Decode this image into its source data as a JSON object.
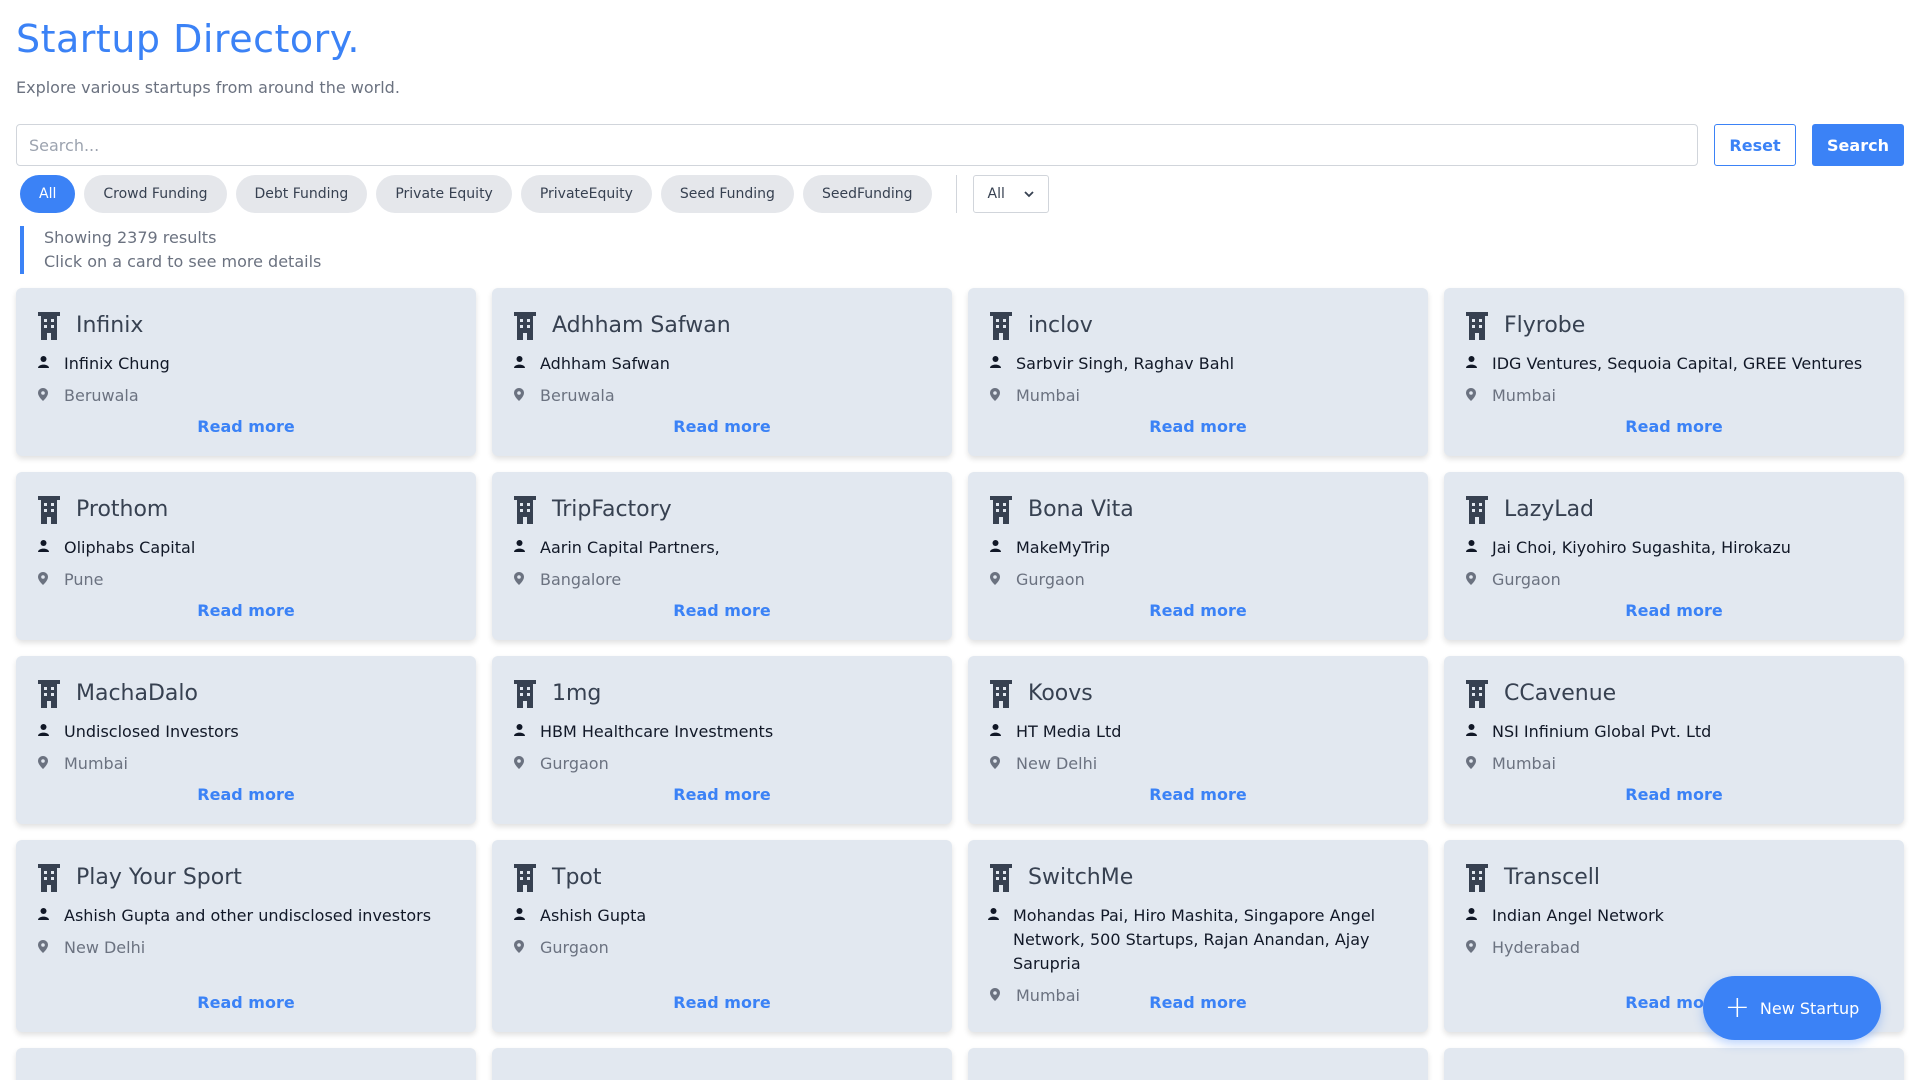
{
  "header": {
    "title": "Startup Directory.",
    "subtitle": "Explore various startups from around the world."
  },
  "search": {
    "placeholder": "Search...",
    "value": "",
    "reset_label": "Reset",
    "search_label": "Search"
  },
  "filters": {
    "chips": [
      "All",
      "Crowd Funding",
      "Debt Funding",
      "Private Equity",
      "PrivateEquity",
      "Seed Funding",
      "SeedFunding"
    ],
    "active": "All",
    "select_value": "All"
  },
  "info": {
    "results": "Showing 2379 results",
    "hint": "Click on a card to see more details"
  },
  "cards": [
    {
      "name": "Infinix",
      "investors": "Infinix Chung",
      "location": "Beruwala"
    },
    {
      "name": "Adhham Safwan",
      "investors": "Adhham Safwan",
      "location": "Beruwala"
    },
    {
      "name": "inclov",
      "investors": "Sarbvir Singh, Raghav Bahl",
      "location": "Mumbai"
    },
    {
      "name": "Flyrobe",
      "investors": "IDG Ventures, Sequoia Capital, GREE Ventures",
      "location": "Mumbai"
    },
    {
      "name": "Prothom",
      "investors": "Oliphabs Capital",
      "location": "Pune"
    },
    {
      "name": "TripFactory",
      "investors": "Aarin Capital Partners,",
      "location": "Bangalore"
    },
    {
      "name": "Bona Vita",
      "investors": "MakeMyTrip",
      "location": "Gurgaon"
    },
    {
      "name": "LazyLad",
      "investors": "Jai Choi, Kiyohiro Sugashita, Hirokazu",
      "location": "Gurgaon"
    },
    {
      "name": "MachaDalo",
      "investors": "Undisclosed Investors",
      "location": "Mumbai"
    },
    {
      "name": "1mg",
      "investors": "HBM Healthcare Investments",
      "location": "Gurgaon"
    },
    {
      "name": "Koovs",
      "investors": "HT Media Ltd",
      "location": "New Delhi"
    },
    {
      "name": "CCavenue",
      "investors": "NSI Infinium Global Pvt. Ltd",
      "location": "Mumbai"
    },
    {
      "name": "Play Your Sport",
      "investors": "Ashish Gupta and other undisclosed investors",
      "location": "New Delhi"
    },
    {
      "name": "Tpot",
      "investors": "Ashish Gupta",
      "location": "Gurgaon"
    },
    {
      "name": "SwitchMe",
      "investors": "Mohandas Pai, Hiro Mashita, Singapore Angel Network, 500 Startups, Rajan Anandan, Ajay Sarupria",
      "location": "Mumbai"
    },
    {
      "name": "Transcell",
      "investors": "Indian Angel Network",
      "location": "Hyderabad"
    }
  ],
  "read_more_label": "Read more",
  "fab": {
    "label": "New Startup"
  },
  "icons": {
    "company": "building-icon",
    "investor": "user-icon",
    "location": "map-pin-icon"
  },
  "colors": {
    "accent": "#3b82f6",
    "card_bg": "#e2e8f0"
  }
}
